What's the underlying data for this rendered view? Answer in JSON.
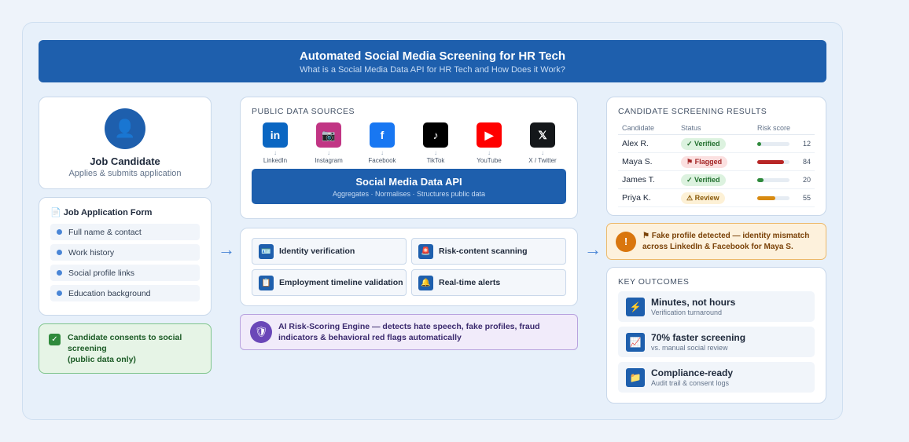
{
  "header": {
    "title": "Automated Social Media Screening for HR Tech",
    "subtitle": "What is a Social Media Data API for HR Tech and How Does it Work?"
  },
  "candidate": {
    "icon": "user-icon",
    "name": "Job Candidate",
    "subtitle": "Applies & submits application"
  },
  "form": {
    "title": "📄 Job Application Form",
    "fields": [
      "Full name & contact",
      "Work history",
      "Social profile links",
      "Education background"
    ]
  },
  "consent": {
    "line1": "Candidate consents to social screening",
    "line2": "(public data only)"
  },
  "sources": {
    "title": "PUBLIC DATA SOURCES",
    "items": [
      {
        "label": "LinkedIn",
        "glyph": "in",
        "color": "#0a66c2"
      },
      {
        "label": "Instagram",
        "glyph": "📷",
        "color": "#c13584"
      },
      {
        "label": "Facebook",
        "glyph": "f",
        "color": "#1877f2"
      },
      {
        "label": "TikTok",
        "glyph": "♪",
        "color": "#000000"
      },
      {
        "label": "YouTube",
        "glyph": "▶",
        "color": "#ff0000"
      },
      {
        "label": "X / Twitter",
        "glyph": "𝕏",
        "color": "#14171a"
      }
    ],
    "arrow": "↓"
  },
  "api": {
    "title": "Social Media Data API",
    "subtitle": "Aggregates · Normalises · Structures public data"
  },
  "features": [
    {
      "label": "Identity verification",
      "glyph": "🪪"
    },
    {
      "label": "Risk-content scanning",
      "glyph": "🚨"
    },
    {
      "label": "Employment timeline validation",
      "glyph": "📋"
    },
    {
      "label": "Real-time alerts",
      "glyph": "🔔"
    }
  ],
  "engine": {
    "glyph": "🛡",
    "text": "AI Risk-Scoring Engine — detects hate speech, fake profiles, fraud indicators & behavioral red flags automatically"
  },
  "results": {
    "title": "CANDIDATE SCREENING RESULTS",
    "columns": [
      "Candidate",
      "Status",
      "Risk score"
    ],
    "rows": [
      {
        "name": "Alex R.",
        "status": "✓ Verified",
        "kind": "verified",
        "score": 12,
        "color": "#2f8a3c"
      },
      {
        "name": "Maya S.",
        "status": "⚑ Flagged",
        "kind": "flagged",
        "score": 84,
        "color": "#b82626"
      },
      {
        "name": "James T.",
        "status": "✓ Verified",
        "kind": "verified",
        "score": 20,
        "color": "#2f8a3c"
      },
      {
        "name": "Priya K.",
        "status": "⚠ Review",
        "kind": "review",
        "score": 55,
        "color": "#d88a10"
      }
    ]
  },
  "alert": {
    "glyph": "!",
    "text": "⚑ Fake profile detected — identity mismatch across LinkedIn & Facebook for Maya S."
  },
  "outcomes": {
    "title": "KEY OUTCOMES",
    "items": [
      {
        "glyph": "⚡",
        "title": "Minutes, not hours",
        "sub": "Verification turnaround"
      },
      {
        "glyph": "📈",
        "title": "70% faster screening",
        "sub": "vs. manual social review"
      },
      {
        "glyph": "📁",
        "title": "Compliance-ready",
        "sub": "Audit trail & consent logs"
      }
    ]
  },
  "colors": {
    "primary": "#1e5fad",
    "accent": "#4a86d6"
  }
}
